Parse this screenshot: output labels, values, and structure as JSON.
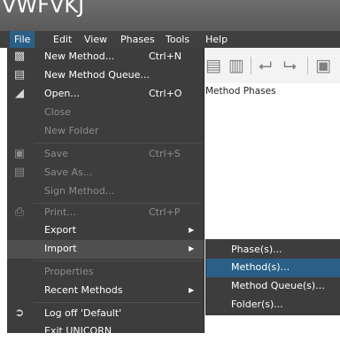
{
  "window": {
    "title": "VWFVKJ"
  },
  "menubar": [
    "File",
    "Edit",
    "View",
    "Phases",
    "Tools",
    "Help"
  ],
  "workspace": {
    "label": "Method Phases"
  },
  "file_menu": [
    {
      "label": "New Method...",
      "shortcut": "Ctrl+N",
      "icon": "new-method-icon"
    },
    {
      "label": "New Method Queue...",
      "shortcut": "",
      "icon": "new-method-queue-icon"
    },
    {
      "label": "Open...",
      "shortcut": "Ctrl+O",
      "icon": "open-folder-icon"
    },
    {
      "label": "Close",
      "shortcut": "",
      "disabled": true
    },
    {
      "label": "New Folder",
      "shortcut": "",
      "disabled": true
    },
    {
      "label": "Save",
      "shortcut": "Ctrl+S",
      "icon": "save-icon",
      "disabled": true
    },
    {
      "label": "Save As...",
      "shortcut": "",
      "icon": "save-as-icon",
      "disabled": true
    },
    {
      "label": "Sign Method...",
      "shortcut": "",
      "disabled": true
    },
    {
      "label": "Print...",
      "shortcut": "Ctrl+P",
      "icon": "print-icon",
      "disabled": true
    },
    {
      "label": "Export",
      "submenu": true
    },
    {
      "label": "Import",
      "submenu": true,
      "highlighted": true
    },
    {
      "label": "Properties",
      "disabled": true
    },
    {
      "label": "Recent Methods",
      "submenu": true
    },
    {
      "label": "Log off 'Default'",
      "icon": "logoff-icon"
    },
    {
      "label": "Exit UNICORN"
    }
  ],
  "import_submenu": [
    {
      "label": "Phase(s)..."
    },
    {
      "label": "Method(s)...",
      "highlighted": true
    },
    {
      "label": "Method Queue(s)..."
    },
    {
      "label": "Folder(s)..."
    }
  ],
  "colors": {
    "menu_bg": "#3d3d3d",
    "menubar_bg": "#404040",
    "highlight": "#4f4f4f",
    "submenu_highlight": "#2a5f87",
    "disabled_text": "#8c8c8c"
  }
}
